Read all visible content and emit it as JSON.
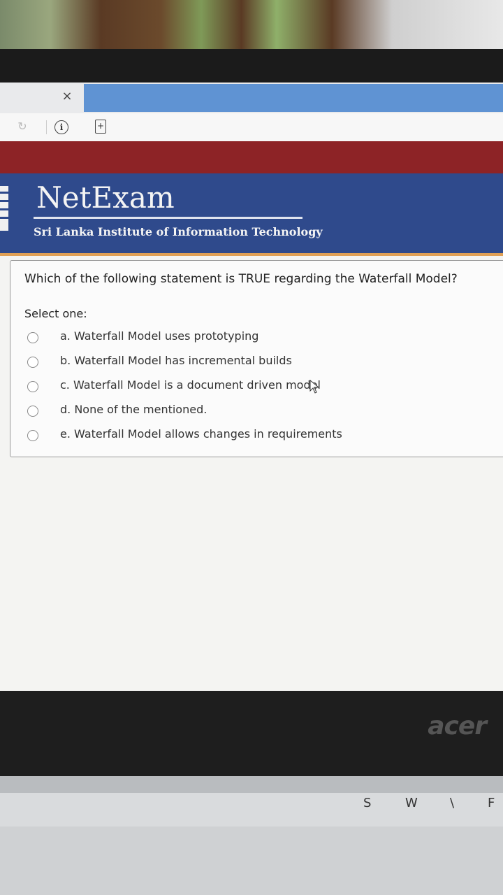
{
  "browser": {
    "close_glyph": "×",
    "reload_glyph": "↻",
    "info_glyph": "i",
    "page_add_glyph": "+"
  },
  "site": {
    "title": "NetExam",
    "subtitle": "Sri Lanka Institute of Information Technology"
  },
  "quiz": {
    "question": "Which of the following statement is TRUE regarding the Waterfall Model?",
    "select_label": "Select one:",
    "options": [
      {
        "label": "a. Waterfall Model uses prototyping",
        "selected": false
      },
      {
        "label": "b. Waterfall Model has incremental builds",
        "selected": false
      },
      {
        "label": "c. Waterfall Model is a document driven model",
        "selected": false
      },
      {
        "label": "d. None of the mentioned.",
        "selected": false
      },
      {
        "label": "e. Waterfall Model allows changes in requirements",
        "selected": false
      }
    ]
  },
  "device": {
    "brand": "acer",
    "keys": [
      "S",
      "W",
      "\\",
      "F"
    ]
  },
  "colors": {
    "header_blue": "#2f4a8c",
    "header_red": "#8d2326",
    "tab_blue": "#5f93d3"
  }
}
